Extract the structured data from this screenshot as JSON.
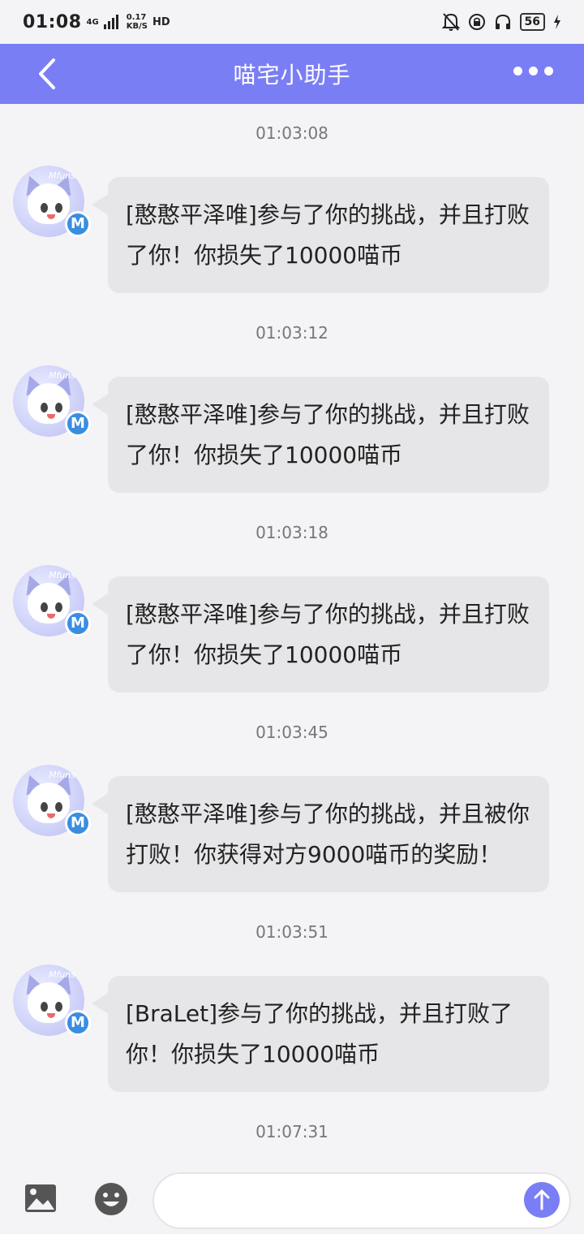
{
  "status_bar": {
    "time": "01:08",
    "network_type": "4G",
    "net_speed": "0.17",
    "net_speed_unit": "KB/S",
    "hd": "HD",
    "battery": "56"
  },
  "header": {
    "title": "喵宅小助手",
    "back_icon": "chevron-left-icon",
    "more_icon": "more-dots-icon"
  },
  "avatar_brand": "Mfuns",
  "avatar_badge": "M",
  "messages": [
    {
      "time": "01:03:08",
      "text": "[憨憨平泽唯]参与了你的挑战，并且打败了你！你损失了10000喵币"
    },
    {
      "time": "01:03:12",
      "text": "[憨憨平泽唯]参与了你的挑战，并且打败了你！你损失了10000喵币"
    },
    {
      "time": "01:03:18",
      "text": "[憨憨平泽唯]参与了你的挑战，并且打败了你！你损失了10000喵币"
    },
    {
      "time": "01:03:45",
      "text": "[憨憨平泽唯]参与了你的挑战，并且被你打败！你获得对方9000喵币的奖励！"
    },
    {
      "time": "01:03:51",
      "text": "[BraLet]参与了你的挑战，并且打败了你！你损失了10000喵币"
    }
  ],
  "trailing_time": "01:07:31",
  "input": {
    "value": "",
    "placeholder": ""
  },
  "colors": {
    "header": "#7a7ef5",
    "bubble": "#e6e6e8",
    "background": "#f4f4f6",
    "badge": "#3b8de0"
  }
}
